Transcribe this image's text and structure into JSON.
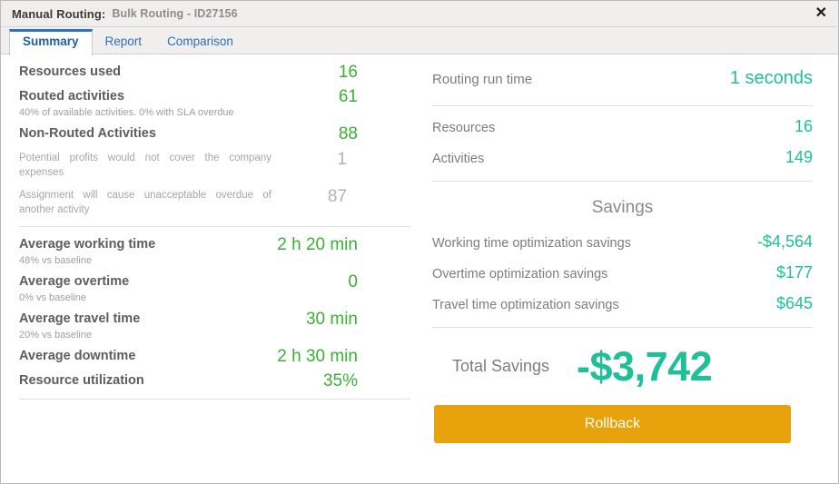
{
  "titlebar": {
    "title": "Manual Routing:",
    "subtitle": "Bulk Routing - ID27156",
    "close_label": "✕"
  },
  "tabs": [
    {
      "label": "Summary",
      "active": true
    },
    {
      "label": "Report",
      "active": false
    },
    {
      "label": "Comparison",
      "active": false
    }
  ],
  "left_panel": {
    "rows": [
      {
        "name": "Resources used",
        "note": "",
        "value": "16"
      },
      {
        "name": "Routed activities",
        "note": "40% of available activities. 0% with SLA overdue",
        "value": "61"
      },
      {
        "name": "Non-Routed Activities",
        "note": "",
        "value": "88"
      }
    ],
    "reasons": [
      {
        "name": "Potential profits would not cover the company expenses",
        "value": "1"
      },
      {
        "name": "Assignment will cause unacceptable overdue of another activity",
        "value": "87"
      }
    ],
    "metrics": [
      {
        "name": "Average working time",
        "note": "48% vs baseline",
        "value": "2 h 20 min"
      },
      {
        "name": "Average overtime",
        "note": "0% vs baseline",
        "value": "0"
      },
      {
        "name": "Average travel time",
        "note": "20% vs baseline",
        "value": "30 min"
      },
      {
        "name": "Average downtime",
        "note": "",
        "value": "2 h 30 min"
      },
      {
        "name": "Resource utilization",
        "note": "",
        "value": "35%"
      }
    ]
  },
  "right_panel": {
    "run_time": {
      "name": "Routing run time",
      "value": "1 seconds"
    },
    "counts": [
      {
        "name": "Resources",
        "value": "16"
      },
      {
        "name": "Activities",
        "value": "149"
      }
    ],
    "savings_heading": "Savings",
    "savings": [
      {
        "name": "Working time optimization savings",
        "value": "-$4,564"
      },
      {
        "name": "Overtime optimization savings",
        "value": "$177"
      },
      {
        "name": "Travel time optimization savings",
        "value": "$645"
      }
    ],
    "total": {
      "label": "Total Savings",
      "value": "-$3,742"
    },
    "rollback_label": "Rollback"
  },
  "colors": {
    "left_value_green": "#3CB034",
    "right_value_teal": "#1FBF9A",
    "rollback_orange": "#E8A30C",
    "tab_active_blue": "#2C74B9"
  }
}
